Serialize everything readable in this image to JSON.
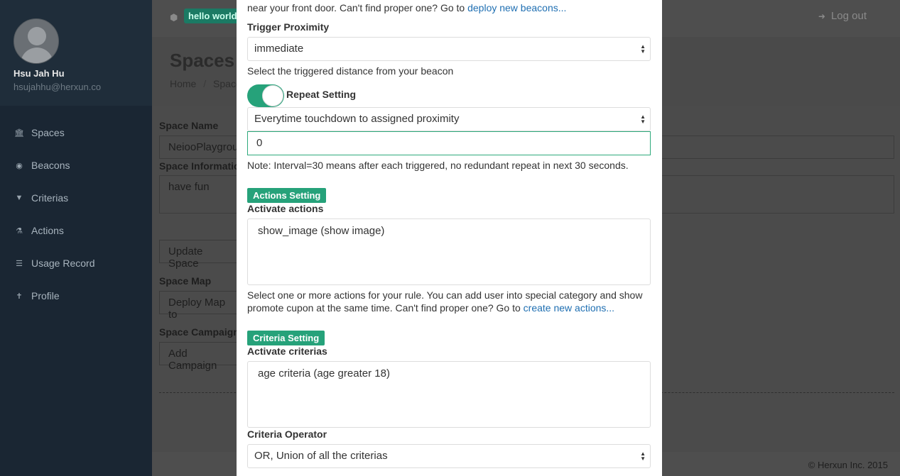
{
  "sidebar": {
    "user_name": "Hsu Jah Hu",
    "user_email": "hsujahhu@herxun.co",
    "items": [
      {
        "icon": "bank-icon",
        "glyph": "🏛",
        "label": "Spaces"
      },
      {
        "icon": "beacon-icon",
        "glyph": "◉",
        "label": "Beacons"
      },
      {
        "icon": "filter-icon",
        "glyph": "▼",
        "label": "Criterias"
      },
      {
        "icon": "flask-icon",
        "glyph": "⚗",
        "label": "Actions"
      },
      {
        "icon": "list-icon",
        "glyph": "☰",
        "label": "Usage Record"
      },
      {
        "icon": "user-icon",
        "glyph": "✝",
        "label": "Profile"
      }
    ]
  },
  "topbar": {
    "badge": "hello world",
    "logout": "Log out"
  },
  "page": {
    "title": "Spaces -",
    "breadcrumb_home": "Home",
    "breadcrumb_sep": "/",
    "breadcrumb_current": "Space",
    "space_name_label": "Space Name",
    "space_name_value": "NeiooPlaygrou",
    "space_info_label": "Space Information",
    "space_info_value": "have fun",
    "update_button": "Update Space",
    "space_map_label": "Space Map",
    "deploy_map_button": "Deploy Map to",
    "space_campaigns_label": "Space Campaigns",
    "add_campaign_button": "Add Campaign"
  },
  "footer": "© Herxun Inc. 2015",
  "modal": {
    "top_text": "near your front door. Can't find proper one? Go to ",
    "top_link": "deploy new beacons...",
    "trigger_label": "Trigger Proximity",
    "trigger_value": "immediate",
    "trigger_help": "Select the triggered distance from your beacon",
    "repeat_label": "Repeat Setting",
    "repeat_enabled": true,
    "repeat_value": "Everytime touchdown to assigned proximity",
    "interval_value": "0",
    "interval_note": "Note: Interval=30 means after each triggered, no redundant repeat in next 30 seconds.",
    "actions_tag": "Actions Setting",
    "actions_label": "Activate actions",
    "actions_value": "show_image (show image)",
    "actions_help_1": "Select one or more actions for your rule. You can add user into special category and show",
    "actions_help_2": "promote cupon at the same time. Can't find proper one? Go to ",
    "actions_link": "create new actions...",
    "criteria_tag": "Criteria Setting",
    "criteria_label": "Activate criterias",
    "criteria_value": "age criteria (age greater 18)",
    "operator_label": "Criteria Operator",
    "operator_value": "OR, Union of all the criterias"
  },
  "colors": {
    "accent": "#26a27a",
    "link": "#1f6fb2",
    "sidebar": "#1a2633"
  }
}
